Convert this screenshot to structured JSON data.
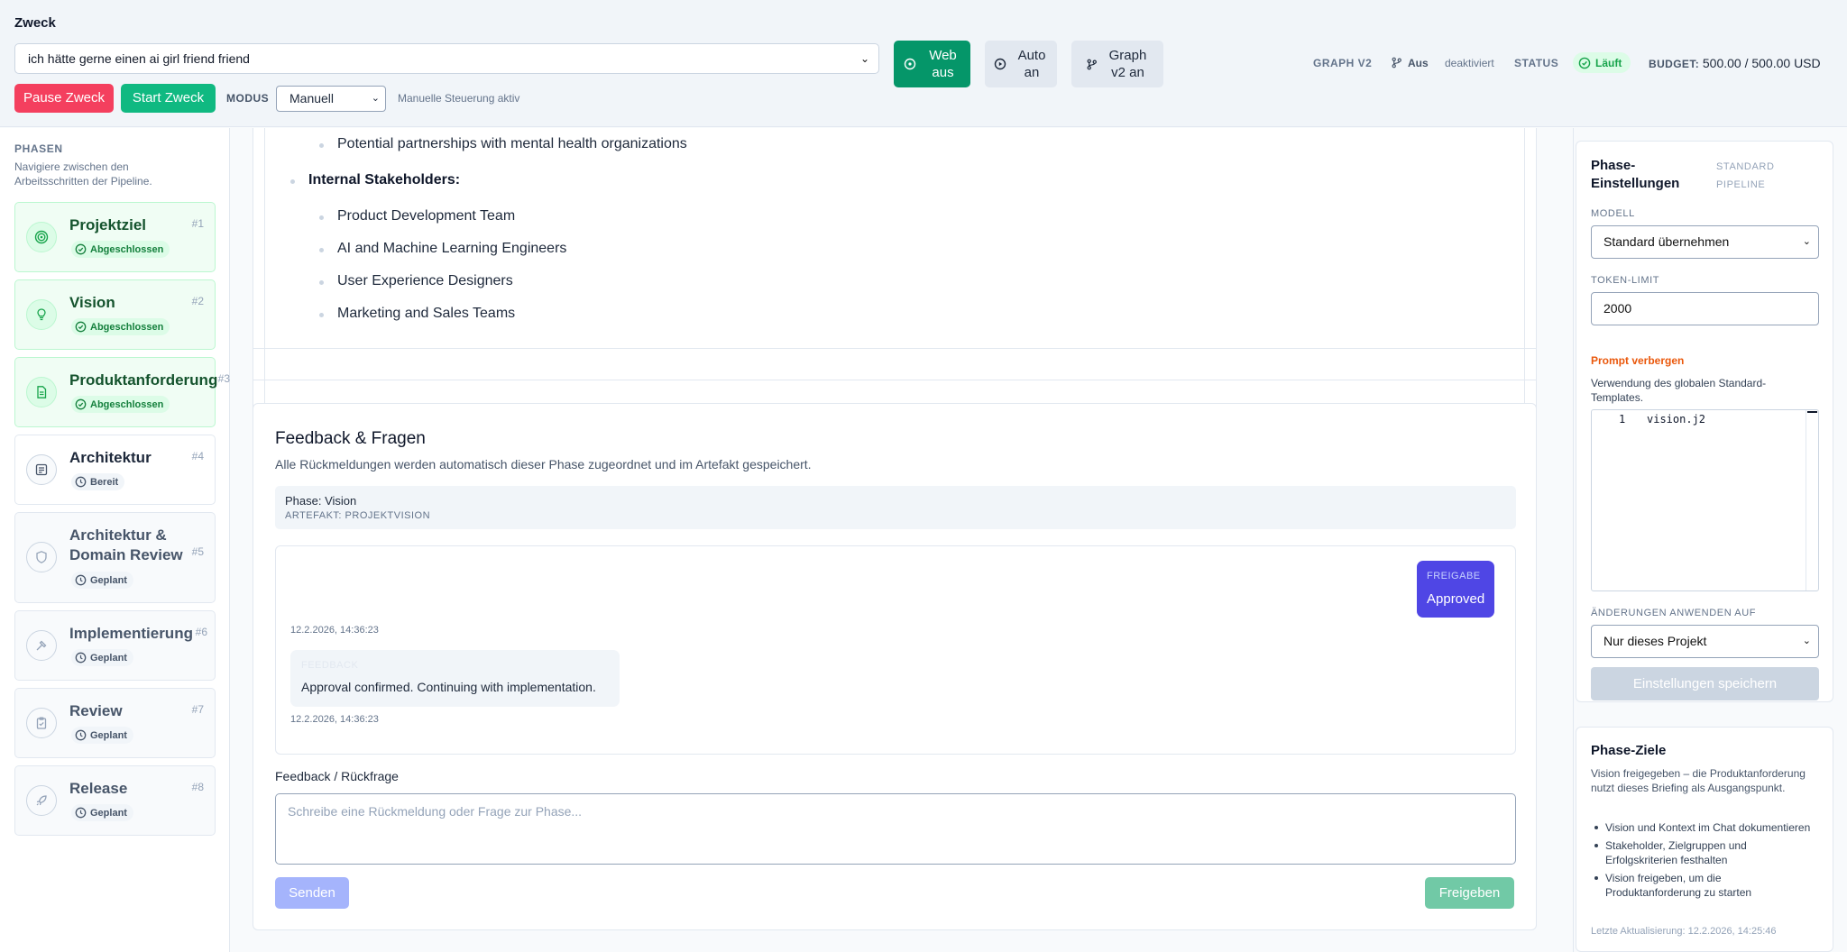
{
  "header": {
    "title": "Zweck",
    "zweck_value": "ich hätte gerne einen ai girl friend friend",
    "pause_label": "Pause Zweck",
    "start_label": "Start Zweck",
    "modus_label": "MODUS",
    "modus_value": "Manuell",
    "modus_info": "Manuelle Steuerung aktiv",
    "web_label": "Web aus",
    "auto_label": "Auto an",
    "graph_label": "Graph v2 an",
    "graph_v2": "GRAPH V2",
    "aus": "Aus",
    "deaktiviert": "deaktiviert",
    "status_label": "STATUS",
    "status_value": "Läuft",
    "budget_label": "BUDGET:",
    "budget_value": "500.00 / 500.00 USD"
  },
  "sidebar": {
    "heading": "PHASEN",
    "description": "Navigiere zwischen den Arbeitsschritten der Pipeline.",
    "phases": [
      {
        "name": "Projektziel",
        "num": "#1",
        "status": "Abgeschlossen",
        "icon": "target-icon"
      },
      {
        "name": "Vision",
        "num": "#2",
        "status": "Abgeschlossen",
        "icon": "lightbulb-icon"
      },
      {
        "name": "Produktanforderung",
        "num": "#3",
        "status": "Abgeschlossen",
        "icon": "document-icon"
      },
      {
        "name": "Architektur",
        "num": "#4",
        "status": "Bereit",
        "icon": "blueprint-icon"
      },
      {
        "name": "Architektur & Domain Review",
        "num": "#5",
        "status": "Geplant",
        "icon": "shield-icon"
      },
      {
        "name": "Implementierung",
        "num": "#6",
        "status": "Geplant",
        "icon": "hammer-icon"
      },
      {
        "name": "Review",
        "num": "#7",
        "status": "Geplant",
        "icon": "clipboard-icon"
      },
      {
        "name": "Release",
        "num": "#8",
        "status": "Geplant",
        "icon": "rocket-icon"
      }
    ]
  },
  "content": {
    "top_items": [
      "Potential partnerships with mental health organizations",
      "Internal Stakeholders:",
      "Product Development Team",
      "AI and Machine Learning Engineers",
      "User Experience Designers",
      "Marketing and Sales Teams"
    ]
  },
  "feedback": {
    "title": "Feedback & Fragen",
    "description": "Alle Rückmeldungen werden automatisch dieser Phase zugeordnet und im Artefakt gespeichert.",
    "phase_line": "Phase: Vision",
    "artifact_line": "ARTEFAKT: PROJEKTVISION",
    "msg1_label": "FREIGABE",
    "msg1_text": "Approved",
    "msg1_time": "12.2.2026, 14:36:23",
    "msg2_label": "FEEDBACK",
    "msg2_text": "Approval confirmed. Continuing with implementation.",
    "msg2_time": "12.2.2026, 14:36:23",
    "input_label": "Feedback / Rückfrage",
    "input_placeholder": "Schreibe eine Rückmeldung oder Frage zur Phase...",
    "send_label": "Senden",
    "approve_label": "Freigeben"
  },
  "settings": {
    "title": "Phase-Einstellungen",
    "pipeline": "STANDARD PIPELINE",
    "model_label": "MODELL",
    "model_value": "Standard übernehmen",
    "token_label": "TOKEN-LIMIT",
    "token_value": "2000",
    "prompt_toggle": "Prompt verbergen",
    "template_info": "Verwendung des globalen Standard-Templates.",
    "code_line_no": "1",
    "code_text": "vision.j2",
    "apply_label": "ÄNDERUNGEN ANWENDEN AUF",
    "apply_value": "Nur dieses Projekt",
    "save_label": "Einstellungen speichern"
  },
  "goals": {
    "title": "Phase-Ziele",
    "description": "Vision freigegeben – die Produktanforderung nutzt dieses Briefing als Ausgangspunkt.",
    "items": [
      "Vision und Kontext im Chat dokumentieren",
      "Stakeholder, Zielgruppen und Erfolgskriterien festhalten",
      "Vision freigeben, um die Produktanforderung zu starten"
    ],
    "updated": "Letzte Aktualisierung: 12.2.2026, 14:25:46"
  },
  "colors": {
    "accent_green": "#10b981",
    "pause_red": "#f43f5e",
    "indigo": "#4f46e5",
    "warning_orange": "#ea580c"
  }
}
